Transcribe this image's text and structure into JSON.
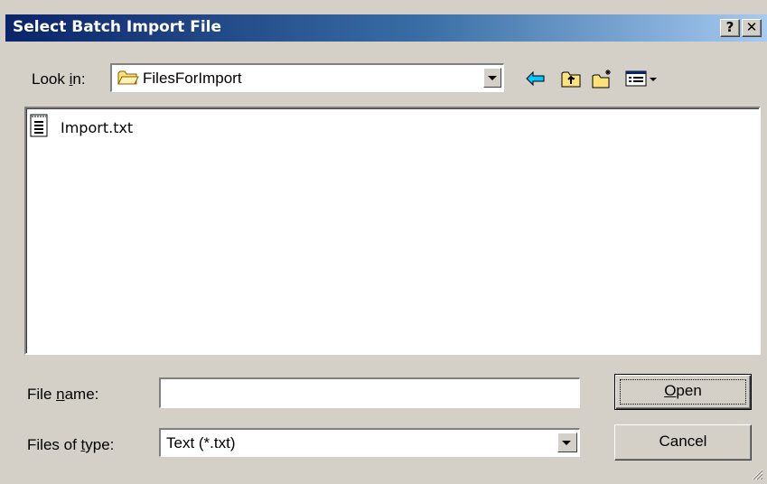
{
  "window": {
    "title": "Select Batch Import File",
    "help_button": "?",
    "close_button": "✕"
  },
  "lookin": {
    "label_pre": "Look ",
    "label_accel": "i",
    "label_post": "n:",
    "value": "FilesForImport"
  },
  "files": [
    {
      "name": "Import.txt",
      "icon": "text-file-icon"
    }
  ],
  "filename": {
    "label_pre": "File ",
    "label_accel": "n",
    "label_post": "ame:",
    "value": "",
    "placeholder": ""
  },
  "filetype": {
    "label_pre": "Files of ",
    "label_accel": "t",
    "label_post": "ype:",
    "value": "Text (*.txt)"
  },
  "buttons": {
    "open_accel": "O",
    "open_rest": "pen",
    "cancel": "Cancel"
  },
  "colors": {
    "title_gradient_start": "#0a246a",
    "title_gradient_end": "#a6caf0",
    "dialog_face": "#d4d0c8",
    "back_arrow": "#00c8ff"
  }
}
